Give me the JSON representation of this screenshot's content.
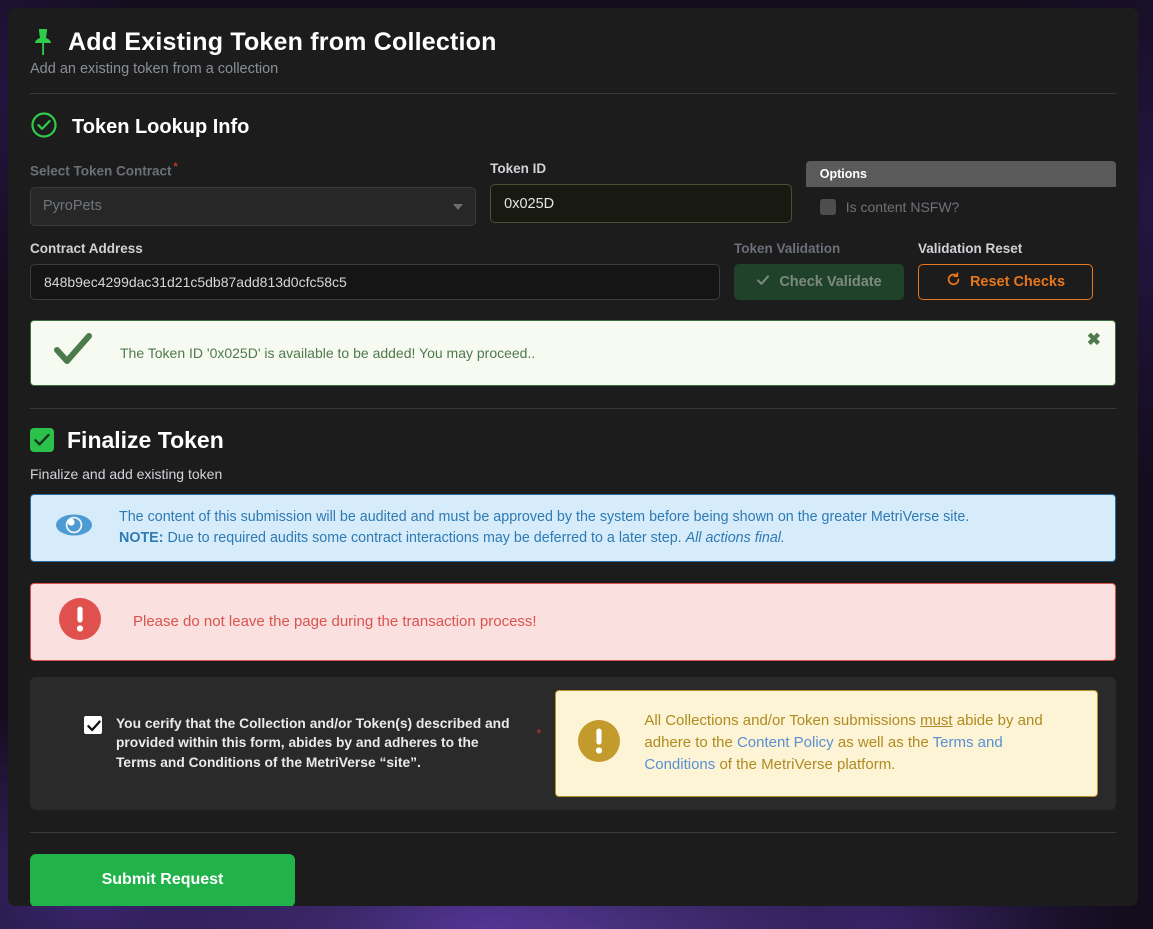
{
  "header": {
    "title": "Add Existing Token from Collection",
    "subtitle": "Add an existing token from a collection",
    "icon": "pin-icon"
  },
  "lookup_section": {
    "title": "Token Lookup Info",
    "icon": "check-circle-icon",
    "select_token_contract": {
      "label": "Select Token Contract",
      "required_marker": "*",
      "value": "PyroPets",
      "caret_icon": "chevron-down-icon"
    },
    "token_id": {
      "label": "Token ID",
      "value": "0x025D"
    },
    "options": {
      "panel_title": "Options",
      "nsfw_label": "Is content NSFW?",
      "nsfw_checked": false
    },
    "contract_address": {
      "label": "Contract Address",
      "value": "848b9ec4299dac31d21c5db87add813d0cfc58c5"
    },
    "token_validation": {
      "label": "Token Validation",
      "button_label": "Check Validate",
      "button_icon": "check-icon",
      "disabled": true
    },
    "validation_reset": {
      "label": "Validation Reset",
      "button_label": "Reset Checks",
      "button_icon": "refresh-icon"
    }
  },
  "success_alert": {
    "icon": "check-mark-icon",
    "message": "The Token ID '0x025D' is available to be added! You may proceed..",
    "close_label": "✖"
  },
  "finalize_section": {
    "title": "Finalize Token",
    "icon": "green-checkbox-icon",
    "subtitle": "Finalize and add existing token"
  },
  "info_alert": {
    "icon": "eye-icon",
    "line1": "The content of this submission will be audited and must be approved by the system before being shown on the greater MetriVerse site.",
    "note_label": "NOTE:",
    "line2": " Due to required audits some contract interactions may be deferred to a later step. ",
    "line2_italic": "All actions final."
  },
  "danger_alert": {
    "icon": "exclamation-circle-icon",
    "message": "Please do not leave the page during the transaction process!"
  },
  "certify": {
    "checked": true,
    "text": "You cerify that the Collection and/or Token(s) described and provided within this form, abides by and adheres to the Terms and Conditions of the MetriVerse “site”.",
    "required_marker": "*"
  },
  "policy_box": {
    "icon": "exclamation-circle-icon",
    "part1": "All Collections and/or Token submissions ",
    "must": "must",
    "part2": " abide by and adhere to the ",
    "link1": "Content Policy",
    "part3": " as well as the ",
    "link2": "Terms and Conditions",
    "part4": " of the MetriVerse platform."
  },
  "submit": {
    "label": "Submit Request"
  },
  "colors": {
    "accent_green": "#22b24a",
    "orange": "#e8761a",
    "info_blue": "#2f7ab3",
    "danger_red": "#d9534f",
    "policy_gold": "#b08a22",
    "card_bg": "#1c1c1c"
  }
}
